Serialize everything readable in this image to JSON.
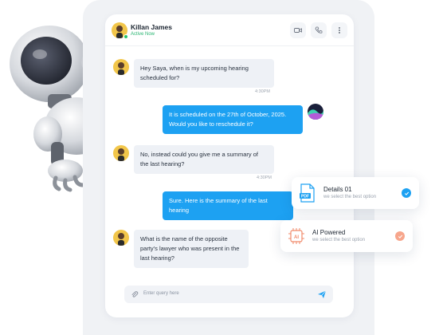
{
  "header": {
    "name": "Killan James",
    "status": "Active Now"
  },
  "messages": [
    {
      "id": "m1",
      "direction": "incoming",
      "text": "Hey Saya, when is my upcoming hearing scheduled for?",
      "time": "4:30PM"
    },
    {
      "id": "m2",
      "direction": "outgoing",
      "text": "It is scheduled on the 27th of October, 2025. Would you like to reschedule it?",
      "time": ""
    },
    {
      "id": "m3",
      "direction": "incoming",
      "text": "No, instead could you give me a summary of the last hearing?",
      "time": "4:30PM"
    },
    {
      "id": "m4",
      "direction": "outgoing",
      "text": "Sure. Here is the summary of the last hearing",
      "time": ""
    },
    {
      "id": "m5",
      "direction": "incoming",
      "text": "What is the name of the opposite party's lawyer who was present in the last hearing?",
      "time": ""
    }
  ],
  "input": {
    "placeholder": "Enter query here"
  },
  "cards": [
    {
      "title": "Details 01",
      "subtitle": "we select the best option",
      "icon": "pdf-icon",
      "check_color": "#1da1f2"
    },
    {
      "title": "AI Powered",
      "subtitle": "we select the best option",
      "icon": "ai-chip-icon",
      "check_color": "#f4a58a"
    }
  ],
  "colors": {
    "accent": "#1da1f2",
    "incoming_bubble": "#eef1f6",
    "online": "#27c36a"
  },
  "icons": [
    "video-call-icon",
    "phone-call-icon",
    "more-options-icon",
    "paperclip-icon",
    "send-icon"
  ]
}
